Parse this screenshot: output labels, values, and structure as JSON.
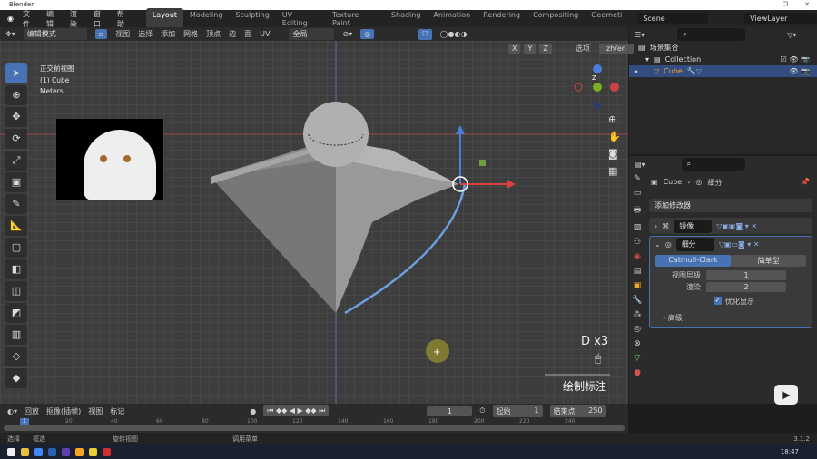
{
  "window": {
    "title": "Blender"
  },
  "menu": [
    "文件",
    "编辑",
    "渲染",
    "窗口",
    "帮助"
  ],
  "workspaces": [
    "Layout",
    "Modeling",
    "Sculpting",
    "UV Editing",
    "Texture Paint",
    "Shading",
    "Animation",
    "Rendering",
    "Compositing",
    "Geometi"
  ],
  "scene": "Scene",
  "view_layer": "ViewLayer",
  "viewport_header": {
    "mode": "编辑模式",
    "menus": [
      "视图",
      "选择",
      "添加",
      "网格",
      "顶点",
      "边",
      "面",
      "UV"
    ],
    "transform": "全局",
    "axes": [
      "X",
      "Y",
      "Z"
    ],
    "options": "选项",
    "lang": "zh/en"
  },
  "overlay": {
    "view": "正交前视图",
    "object": "(1) Cube",
    "units": "Meters"
  },
  "gizmo": {
    "axes": [
      "Z",
      "Y",
      "X"
    ]
  },
  "hint": {
    "keys": "D x3",
    "action": "绘制标注"
  },
  "outliner": {
    "root": "场景集合",
    "collection": "Collection",
    "object": "Cube"
  },
  "properties": {
    "object": "Cube",
    "modifier_ctx": "细分",
    "add_modifier": "添加修改器",
    "modifiers": [
      {
        "name": "镜像",
        "expanded": false
      },
      {
        "name": "细分",
        "expanded": true
      }
    ],
    "subdiv": {
      "types": [
        "Catmull-Clark",
        "简单型"
      ],
      "selected": "Catmull-Clark",
      "viewport_label": "视图层级",
      "viewport": "1",
      "render_label": "渲染",
      "render": "2",
      "optimal_label": "优化显示",
      "optimal": true,
      "advanced": "高级"
    }
  },
  "timeline": {
    "menus": [
      "回放",
      "抠像(插帧)",
      "视图",
      "标记"
    ],
    "frame": "1",
    "start_label": "起始",
    "start": "1",
    "end_label": "结束点",
    "end": "250",
    "ticks": [
      "1",
      "20",
      "40",
      "60",
      "80",
      "100",
      "120",
      "140",
      "160",
      "180",
      "200",
      "220",
      "240"
    ]
  },
  "status": {
    "items": [
      "选择",
      "框选",
      "旋转视图",
      "调用菜单"
    ],
    "version": "3.1.2"
  },
  "taskbar": {
    "time": "18:47"
  },
  "colors": {
    "accent": "#4772b3",
    "active_object": "#f5a623",
    "curve": "#6b9fe0"
  }
}
